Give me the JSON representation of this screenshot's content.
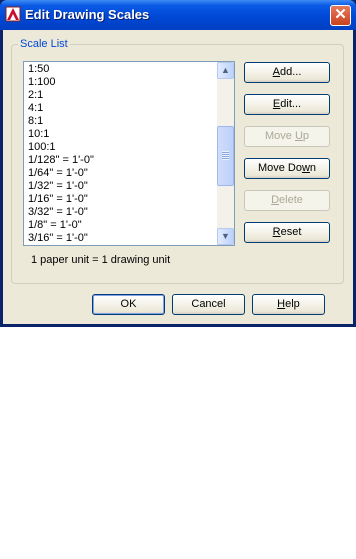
{
  "window": {
    "title": "Edit Drawing Scales"
  },
  "group": {
    "label": "Scale List"
  },
  "scale_list": {
    "items": [
      "1:50",
      "1:100",
      "2:1",
      "4:1",
      "8:1",
      "10:1",
      "100:1",
      "1/128\" = 1'-0\"",
      "1/64\" = 1'-0\"",
      "1/32\" = 1'-0\"",
      "1/16\" = 1'-0\"",
      "3/32\" = 1'-0\"",
      "1/8\" = 1'-0\"",
      "3/16\" = 1'-0\""
    ]
  },
  "unit_text": "1 paper unit = 1 drawing unit",
  "buttons": {
    "add": {
      "pre": "",
      "key": "A",
      "post": "dd..."
    },
    "edit": {
      "pre": "",
      "key": "E",
      "post": "dit..."
    },
    "move_up": {
      "pre": "Move ",
      "key": "U",
      "post": "p"
    },
    "move_down": {
      "pre": "Move Do",
      "key": "w",
      "post": "n"
    },
    "delete": {
      "pre": "",
      "key": "D",
      "post": "elete"
    },
    "reset": {
      "pre": "",
      "key": "R",
      "post": "eset"
    },
    "ok": "OK",
    "cancel": "Cancel",
    "help": {
      "pre": "",
      "key": "H",
      "post": "elp"
    }
  },
  "icons": {
    "app": "autocad-icon",
    "close": "close-icon",
    "scroll_up": "arrow-up-icon",
    "scroll_down": "arrow-down-icon"
  }
}
